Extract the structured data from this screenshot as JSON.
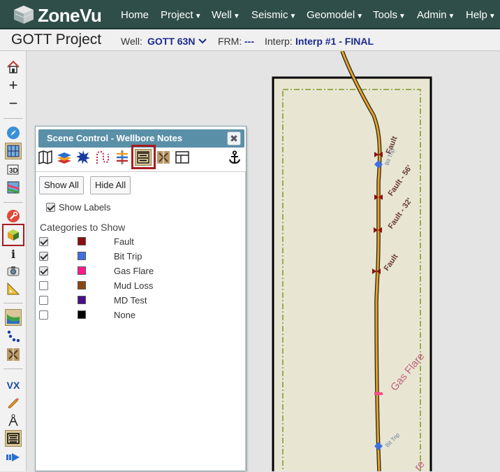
{
  "app": {
    "name": "ZoneVu"
  },
  "nav": {
    "home": "Home",
    "project": "Project",
    "well": "Well",
    "seismic": "Seismic",
    "geomodel": "Geomodel",
    "tools": "Tools",
    "admin": "Admin",
    "help": "Help"
  },
  "project_bar": {
    "title": "GOTT Project",
    "well_label": "Well:",
    "well_value": "GOTT 63N",
    "frm_label": "FRM:",
    "frm_value": "---",
    "interp_label": "Interp:",
    "interp_value": "Interp #1 - FINAL"
  },
  "left_toolbar": {
    "icons": [
      "home-icon",
      "zoom-in-icon",
      "zoom-out-icon",
      "compass-icon",
      "map-view-icon",
      "3d-icon",
      "cross-section-icon",
      "wrench-icon",
      "layers-cube-icon",
      "info-icon",
      "camera-icon",
      "ruler-icon",
      "horizon-icon",
      "points-icon",
      "fault-icon",
      "vx-icon",
      "pencil-icon",
      "tool-icon",
      "notes-icon",
      "forward-icon"
    ],
    "info_glyph": "i",
    "vx_label": "VX"
  },
  "panel": {
    "title": "Scene Control - Wellbore Notes",
    "close_glyph": "✖",
    "show_all": "Show All",
    "hide_all": "Hide All",
    "show_labels": "Show Labels",
    "show_labels_checked": true,
    "categories_heading": "Categories to Show",
    "categories": [
      {
        "label": "Fault",
        "color": "#8b0f0f",
        "checked": true
      },
      {
        "label": "Bit Trip",
        "color": "#3f6fe0",
        "checked": true
      },
      {
        "label": "Gas Flare",
        "color": "#ff1a8c",
        "checked": true
      },
      {
        "label": "Mud Loss",
        "color": "#8b4513",
        "checked": false
      },
      {
        "label": "MD Test",
        "color": "#4b0f8b",
        "checked": false
      },
      {
        "label": "None",
        "color": "#000000",
        "checked": false
      }
    ]
  },
  "canvas": {
    "annotations": {
      "fault_1": "Fault",
      "bit_trip_1": "Bit Trip",
      "fault_56": "Fault - 56'",
      "fault_32": "Fault - 32'",
      "fault_2": "Fault",
      "gas_flare": "Gas Flare",
      "bit_trip_2": "Bit Trip",
      "gas_flare_cut": "re"
    }
  },
  "colors": {
    "navbar": "#2f4e49",
    "accent_blue": "#1a2a8c",
    "panel_header": "#5a8fa8",
    "highlight": "#a51c20",
    "well_path": "#e8a324",
    "zone_fill": "#e8e6d2",
    "zone_border": "#7a9a2a"
  }
}
